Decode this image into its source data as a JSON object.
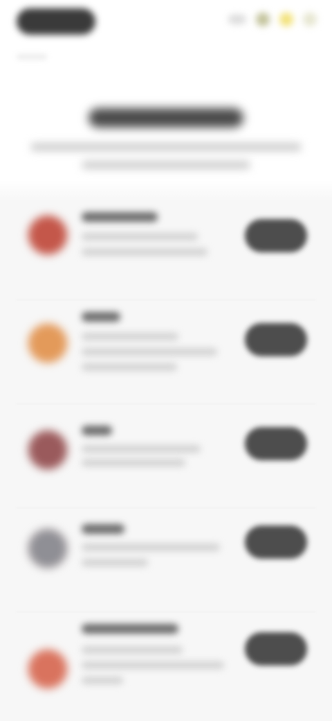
{
  "colors": {
    "page_background": "#ffffff",
    "list_background": "#f7f7f7",
    "action_button": "#4d4d4d",
    "heading": "#4a4a4a"
  },
  "header": {
    "icons": [
      "back-pill",
      "status-dot",
      "status-dot",
      "status-dot"
    ]
  },
  "list": {
    "items": [
      {
        "avatar_color": "#c4574a",
        "icon": "avatar-icon"
      },
      {
        "avatar_color": "#e39a5a",
        "icon": "avatar-icon"
      },
      {
        "avatar_color": "#9a5a5c",
        "icon": "avatar-icon"
      },
      {
        "avatar_color": "#8f8f95",
        "icon": "avatar-icon"
      },
      {
        "avatar_color": "#d9735e",
        "icon": "avatar-icon"
      }
    ]
  }
}
